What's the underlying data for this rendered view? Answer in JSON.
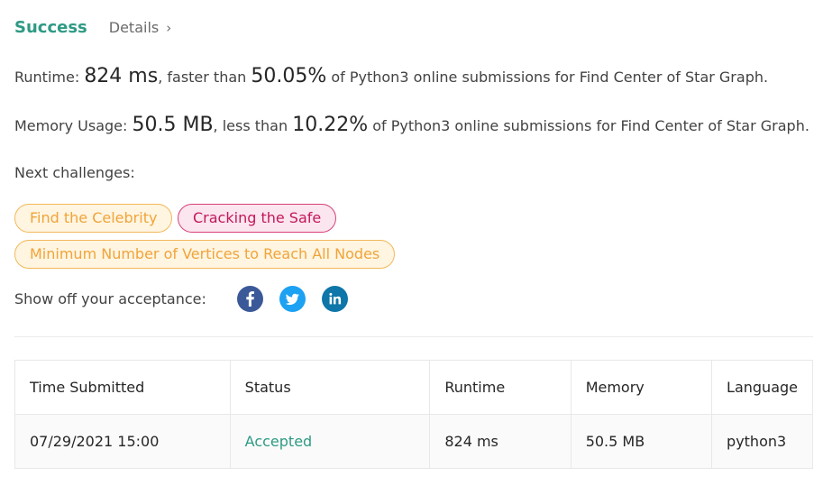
{
  "header": {
    "status": "Success",
    "details_label": "Details",
    "details_chevron": "›"
  },
  "runtime": {
    "label": "Runtime: ",
    "value": "824 ms",
    "mid_text": ", faster than ",
    "percent": "50.05%",
    "suffix": " of Python3 online submissions for Find Center of Star Graph."
  },
  "memory": {
    "label": "Memory Usage: ",
    "value": "50.5 MB",
    "mid_text": ", less than ",
    "percent": "10.22%",
    "suffix": " of Python3 online submissions for Find Center of Star Graph."
  },
  "next_challenges": {
    "label": "Next challenges:",
    "items": [
      {
        "label": "Find the Celebrity",
        "difficulty_color": "#f0a43a"
      },
      {
        "label": "Cracking the Safe",
        "difficulty_color": "#c2185b"
      },
      {
        "label": "Minimum Number of Vertices to Reach All Nodes",
        "difficulty_color": "#f0a43a"
      }
    ]
  },
  "share": {
    "label": "Show off your acceptance:",
    "icons": [
      "facebook-icon",
      "twitter-icon",
      "linkedin-icon"
    ]
  },
  "table": {
    "headers": [
      "Time Submitted",
      "Status",
      "Runtime",
      "Memory",
      "Language"
    ],
    "rows": [
      {
        "time": "07/29/2021 15:00",
        "status": "Accepted",
        "runtime": "824 ms",
        "memory": "50.5 MB",
        "language": "python3"
      }
    ]
  },
  "colors": {
    "success": "#2e9a84",
    "medium": "#f0a43a",
    "hard": "#c2185b",
    "facebook": "#3b5998",
    "twitter": "#1da1f2",
    "linkedin": "#0e76a8"
  }
}
